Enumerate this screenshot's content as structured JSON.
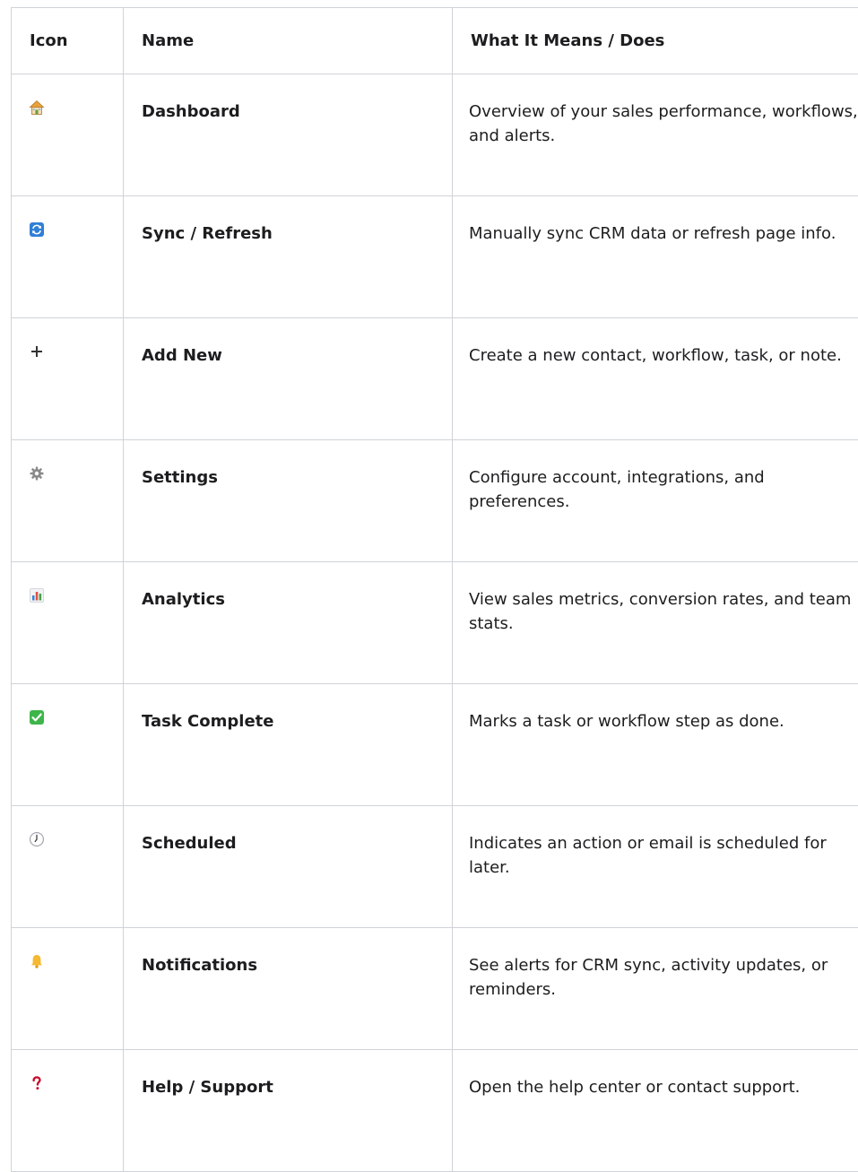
{
  "table": {
    "headers": {
      "icon": "Icon",
      "name": "Name",
      "description": "What It Means / Does"
    },
    "rows": [
      {
        "icon": "house-icon",
        "name": "Dashboard",
        "description": "Overview of your sales performance, workflows, and alerts."
      },
      {
        "icon": "refresh-icon",
        "name": "Sync / Refresh",
        "description": "Manually sync CRM data or refresh page info."
      },
      {
        "icon": "plus-icon",
        "name": "Add New",
        "description": "Create a new contact, workflow, task, or note."
      },
      {
        "icon": "gear-icon",
        "name": "Settings",
        "description": "Configure account, integrations, and preferences."
      },
      {
        "icon": "bar-chart-icon",
        "name": "Analytics",
        "description": "View sales metrics, conversion rates, and team stats."
      },
      {
        "icon": "checkmark-icon",
        "name": "Task Complete",
        "description": "Marks a task or workflow step as done."
      },
      {
        "icon": "clock-icon",
        "name": "Scheduled",
        "description": "Indicates an action or email is scheduled for later."
      },
      {
        "icon": "bell-icon",
        "name": "Notifications",
        "description": "See alerts for CRM sync, activity updates, or reminders."
      },
      {
        "icon": "question-mark-icon",
        "name": "Help / Support",
        "description": "Open the help center or contact support."
      }
    ]
  },
  "colors": {
    "border": "#cfd3d8",
    "text": "#1d1d1f",
    "refresh": "#2f7fd6",
    "checkmark": "#3db54a",
    "bell": "#f5b82e",
    "question": "#c8102e"
  }
}
